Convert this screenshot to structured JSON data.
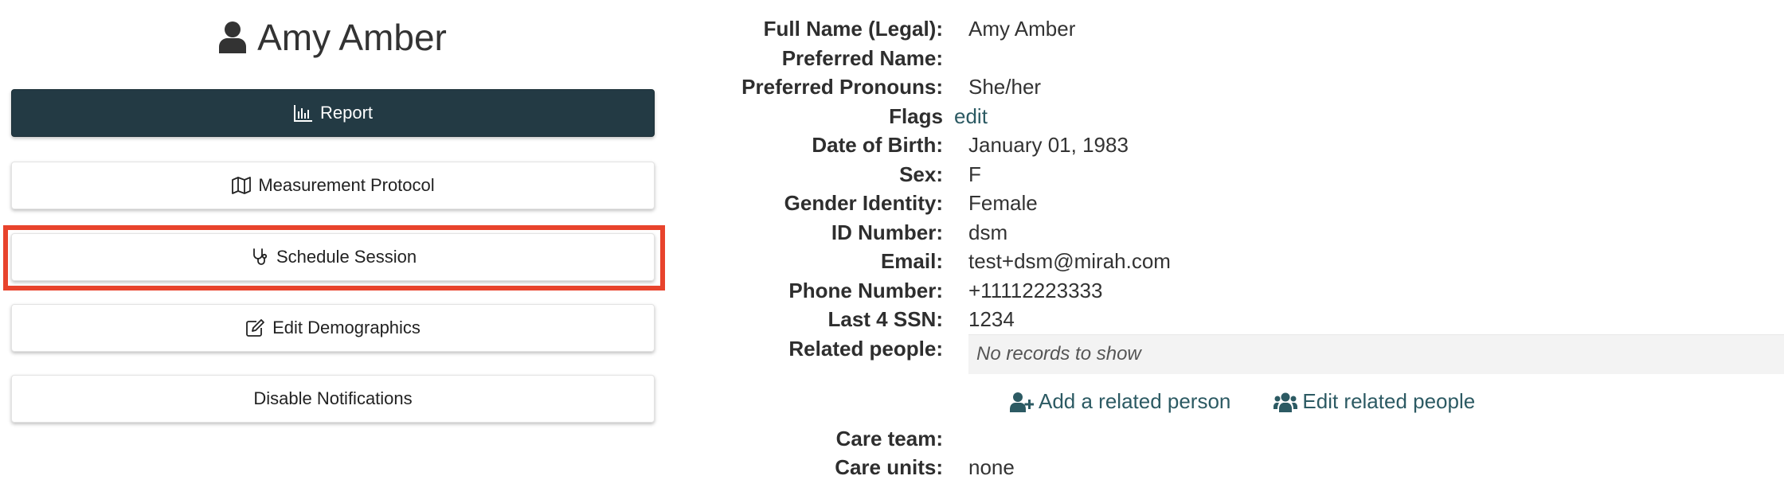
{
  "patient": {
    "name": "Amy Amber"
  },
  "actions": {
    "report_label": "Report",
    "protocol_label": "Measurement Protocol",
    "schedule_label": "Schedule Session",
    "demographics_label": "Edit Demographics",
    "notifications_label": "Disable Notifications"
  },
  "details": {
    "full_name_label": "Full Name (Legal):",
    "full_name": "Amy Amber",
    "preferred_name_label": "Preferred Name:",
    "preferred_name": "",
    "pronouns_label": "Preferred Pronouns:",
    "pronouns": "She/her",
    "flags_label": "Flags",
    "flags_edit": "edit",
    "dob_label": "Date of Birth:",
    "dob": "January 01, 1983",
    "sex_label": "Sex:",
    "sex": "F",
    "gender_label": "Gender Identity:",
    "gender": "Female",
    "id_label": "ID Number:",
    "id": "dsm",
    "email_label": "Email:",
    "email": "test+dsm@mirah.com",
    "phone_label": "Phone Number:",
    "phone": "+11112223333",
    "ssn_label": "Last 4 SSN:",
    "ssn": "1234",
    "related_label": "Related people:",
    "related_empty": "No records to show",
    "add_related": "Add a related person",
    "edit_related": "Edit related people",
    "care_team_label": "Care team:",
    "care_team": "",
    "care_units_label": "Care units:",
    "care_units": "none"
  },
  "colors": {
    "primary_dark": "#233a44",
    "link": "#2c5a63",
    "highlight": "#e8432c"
  },
  "icons": [
    "user-icon",
    "bar-chart-icon",
    "map-icon",
    "stethoscope-icon",
    "edit-icon",
    "user-plus-icon",
    "users-icon"
  ]
}
